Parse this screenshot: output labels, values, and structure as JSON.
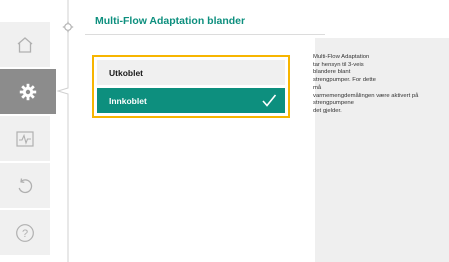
{
  "colors": {
    "accent": "#0d8f7e",
    "focus_border": "#f7b500",
    "rail_active": "#8c8c8c",
    "rail_button": "#f0f0f0",
    "help_background": "#efefef"
  },
  "nav": {
    "items": [
      {
        "icon": "home-icon",
        "active": false
      },
      {
        "icon": "gear-icon",
        "active": true
      },
      {
        "icon": "diagnostics-icon",
        "active": false
      },
      {
        "icon": "undo-icon",
        "active": false
      },
      {
        "icon": "help-icon",
        "active": false
      }
    ]
  },
  "header": {
    "title": "Multi-Flow Adaptation blander",
    "context_icon": "gear-icon"
  },
  "options": [
    {
      "label": "Utkoblet",
      "selected": false
    },
    {
      "label": "Innkoblet",
      "selected": true,
      "indicator": "checkmark-icon"
    }
  ],
  "help": {
    "text": "Multi-Flow Adaptation\ntar hensyn til 3-veis\nblandere blant\nstrengpumper. For dette\nmå\nvarmemengdemålingen være aktivert på\nstrengpumpene\ndet gjelder."
  }
}
